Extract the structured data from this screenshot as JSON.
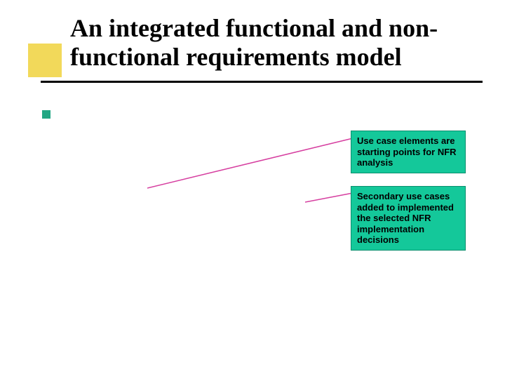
{
  "title": "An integrated functional and non-functional requirements model",
  "callouts": {
    "c1": "Use case elements are starting points for NFR analysis",
    "c2": "Secondary use cases added to implemented the selected NFR implementation decisions"
  }
}
